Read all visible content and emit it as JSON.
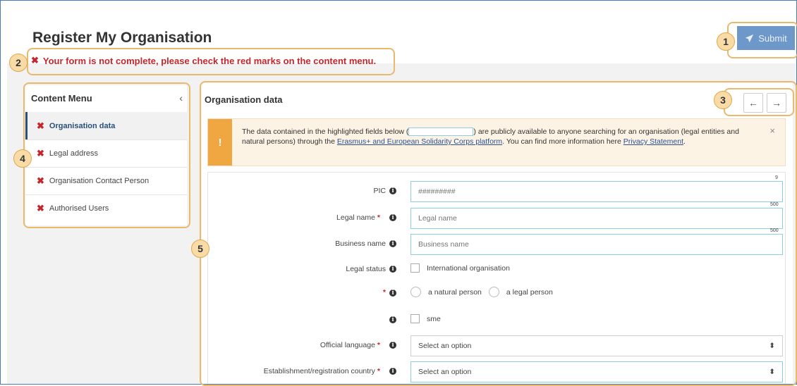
{
  "page": {
    "title": "Register My Organisation"
  },
  "header": {
    "submit_label": "Submit",
    "submit_icon": "paper-plane-icon"
  },
  "error": {
    "message": "Your form is not complete, please check the red marks on the content menu."
  },
  "callouts": [
    "1",
    "2",
    "3",
    "4",
    "5"
  ],
  "content_menu": {
    "title": "Content Menu",
    "collapse_symbol": "‹",
    "items": [
      {
        "label": "Organisation data",
        "status": "incomplete",
        "active": true
      },
      {
        "label": "Legal address",
        "status": "incomplete",
        "active": false
      },
      {
        "label": "Organisation Contact Person",
        "status": "incomplete",
        "active": false
      },
      {
        "label": "Authorised Users",
        "status": "incomplete",
        "active": false
      }
    ]
  },
  "panel": {
    "title": "Organisation data",
    "prev_symbol": "←",
    "next_symbol": "→"
  },
  "notice": {
    "warning_symbol": "!",
    "text_before": "The data contained in the highlighted fields below (",
    "text_middle": ") are publicly available to anyone searching for an organisation (legal entities and natural persons) through the ",
    "link1": "Erasmus+ and European Solidarity Corps platform",
    "text_after": ". You can find more information here ",
    "link2": "Privacy Statement",
    "text_end": ".",
    "close_symbol": "×"
  },
  "form": {
    "pic": {
      "label": "PIC",
      "placeholder": "#########",
      "counter": "9"
    },
    "legal_name": {
      "label": "Legal name",
      "placeholder": "Legal name",
      "counter": "500"
    },
    "business_name": {
      "label": "Business name",
      "placeholder": "Business name",
      "counter": "500"
    },
    "legal_status": {
      "label": "Legal status",
      "option": "International organisation"
    },
    "person_type": {
      "option1": "a natural person",
      "option2": "a legal person"
    },
    "sme": {
      "option": "sme"
    },
    "official_language": {
      "label": "Official language",
      "value": "Select an option"
    },
    "country": {
      "label": "Establishment/registration country",
      "value": "Select an option"
    },
    "required_marker": "*",
    "info_symbol": "i",
    "select_arrow": "⬍"
  },
  "colors": {
    "accent": "#2a4f7c",
    "error": "#c3262d",
    "highlight": "#8bcfe0",
    "warning": "#f0a741",
    "callout": "#e9b96e"
  }
}
